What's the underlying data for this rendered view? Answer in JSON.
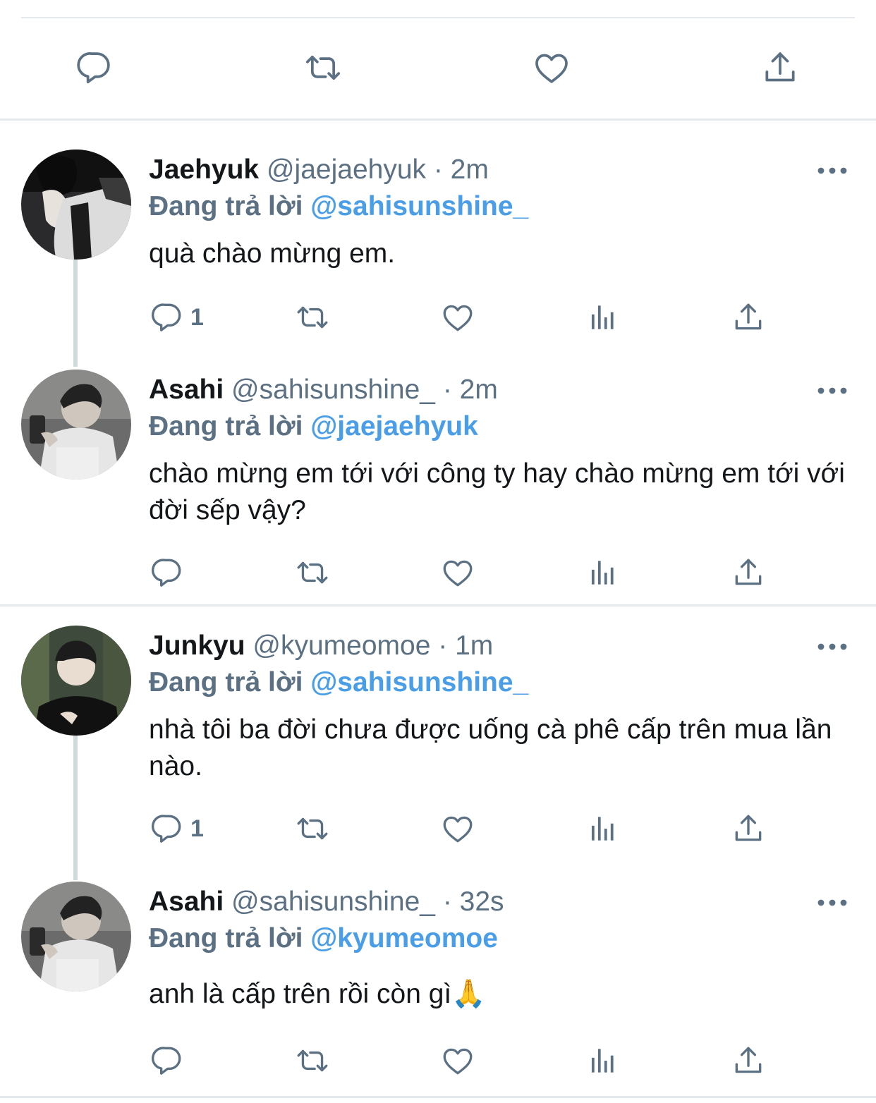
{
  "colors": {
    "text": "#14171a",
    "muted": "#5b7083",
    "mention": "#4a9ee8",
    "divider": "#e6e9ec",
    "thread_line": "#cfd9de"
  },
  "top_actions": [
    "reply-icon",
    "retweet-icon",
    "like-icon",
    "share-icon"
  ],
  "reply_label": "Đang trả lời",
  "tweets": [
    {
      "name": "Jaehyuk",
      "handle": "@jaejaehyuk",
      "time": "· 2m",
      "reply_to": "@sahisunshine_",
      "text": "quà chào mừng em.",
      "reply_count": "1",
      "avatar": "jaehyuk-avatar"
    },
    {
      "name": "Asahi",
      "handle": "@sahisunshine_",
      "time": "· 2m",
      "reply_to": "@jaejaehyuk",
      "text": "chào mừng em tới với công ty hay chào mừng em tới với đời sếp vậy?",
      "reply_count": "",
      "avatar": "asahi-avatar"
    },
    {
      "name": "Junkyu",
      "handle": "@kyumeomoe",
      "time": "· 1m",
      "reply_to": "@sahisunshine_",
      "text": "nhà tôi ba đời chưa được uống cà phê cấp trên mua lần nào.",
      "reply_count": "1",
      "avatar": "junkyu-avatar"
    },
    {
      "name": "Asahi",
      "handle": "@sahisunshine_",
      "time": "· 32s",
      "reply_to": "@kyumeomoe",
      "text": "anh là cấp trên rồi còn gì🙏",
      "reply_count": "",
      "avatar": "asahi-avatar"
    }
  ]
}
